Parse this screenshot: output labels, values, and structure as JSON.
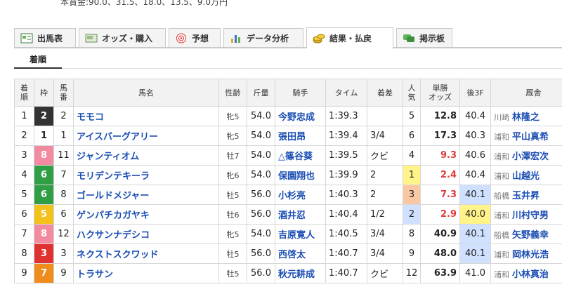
{
  "prize_text": "本賞金:90.0、31.5、18.0、13.5、9.0万円",
  "tabs": [
    {
      "label": "出馬表",
      "icon": "race-card-icon",
      "active": false
    },
    {
      "label": "オッズ・購入",
      "icon": "ticket-icon",
      "active": false
    },
    {
      "label": "予想",
      "icon": "target-icon",
      "active": false
    },
    {
      "label": "データ分析",
      "icon": "bar-chart-icon",
      "active": false
    },
    {
      "label": "結果・払戻",
      "icon": "coins-icon",
      "active": true
    },
    {
      "label": "掲示板",
      "icon": "chat-icon",
      "active": false
    }
  ],
  "subtab": "着順",
  "headers": [
    "着\n順",
    "枠",
    "馬\n番",
    "馬名",
    "性齢",
    "斤量",
    "騎手",
    "タイム",
    "着差",
    "人\n気",
    "単勝\nオッズ",
    "後3F",
    "厩舎"
  ],
  "waku_colors": {
    "1": {
      "bg": "#ffffff",
      "fg": "#222222"
    },
    "2": {
      "bg": "#333333",
      "fg": "#ffffff"
    },
    "5": {
      "bg": "#f2c21b",
      "fg": "#ffffff"
    },
    "6": {
      "bg": "#2f9e44",
      "fg": "#ffffff"
    },
    "7": {
      "bg": "#f08c1e",
      "fg": "#ffffff"
    },
    "8": {
      "bg": "#f28aa0",
      "fg": "#ffffff"
    },
    "3": {
      "bg": "#e03131",
      "fg": "#ffffff"
    }
  },
  "rows": [
    {
      "rank": "1",
      "waku": "2",
      "num": "2",
      "horse": "モモコ",
      "sexage": "牝5",
      "weight": "54.0",
      "jockey": "今野忠成",
      "time": "1:39.3",
      "margin": "",
      "pop": "5",
      "pop_hl": "",
      "odds": "12.8",
      "odds_red": false,
      "last3f": "40.4",
      "f3_hl": "",
      "region": "川崎",
      "trainer": "林隆之"
    },
    {
      "rank": "2",
      "waku": "1",
      "num": "1",
      "horse": "アイスバーグアリー",
      "sexage": "牝5",
      "weight": "54.0",
      "jockey": "張田昂",
      "time": "1:39.4",
      "margin": "3/4",
      "pop": "6",
      "pop_hl": "",
      "odds": "17.3",
      "odds_red": false,
      "last3f": "40.3",
      "f3_hl": "",
      "region": "浦和",
      "trainer": "平山真希"
    },
    {
      "rank": "3",
      "waku": "8",
      "num": "11",
      "horse": "ジャンティオム",
      "sexage": "牡7",
      "weight": "54.0",
      "jockey": "△篠谷葵",
      "time": "1:39.5",
      "margin": "クビ",
      "pop": "4",
      "pop_hl": "",
      "odds": "9.3",
      "odds_red": true,
      "last3f": "40.6",
      "f3_hl": "",
      "region": "浦和",
      "trainer": "小澤宏次"
    },
    {
      "rank": "4",
      "waku": "6",
      "num": "7",
      "horse": "モリデンテキーラ",
      "sexage": "牝6",
      "weight": "54.0",
      "jockey": "保園翔也",
      "time": "1:39.9",
      "margin": "2",
      "pop": "1",
      "pop_hl": "rank1",
      "odds": "2.4",
      "odds_red": true,
      "last3f": "40.4",
      "f3_hl": "",
      "region": "浦和",
      "trainer": "山越光"
    },
    {
      "rank": "5",
      "waku": "6",
      "num": "8",
      "horse": "ゴールドメジャー",
      "sexage": "牡5",
      "weight": "56.0",
      "jockey": "小杉亮",
      "time": "1:40.3",
      "margin": "2",
      "pop": "3",
      "pop_hl": "rank3",
      "odds": "7.3",
      "odds_red": true,
      "last3f": "40.1",
      "f3_hl": "rank2",
      "region": "船橋",
      "trainer": "玉井昇"
    },
    {
      "rank": "6",
      "waku": "5",
      "num": "6",
      "horse": "ゲンパチカガヤキ",
      "sexage": "牡6",
      "weight": "56.0",
      "jockey": "酒井忍",
      "time": "1:40.4",
      "margin": "1/2",
      "pop": "2",
      "pop_hl": "rank2",
      "odds": "2.9",
      "odds_red": true,
      "last3f": "40.0",
      "f3_hl": "rank1",
      "region": "浦和",
      "trainer": "川村守男"
    },
    {
      "rank": "7",
      "waku": "8",
      "num": "12",
      "horse": "ハクサンナデシコ",
      "sexage": "牝5",
      "weight": "54.0",
      "jockey": "吉原寛人",
      "time": "1:40.5",
      "margin": "3/4",
      "pop": "8",
      "pop_hl": "",
      "odds": "40.9",
      "odds_red": false,
      "last3f": "40.1",
      "f3_hl": "rank2",
      "region": "船橋",
      "trainer": "矢野義幸"
    },
    {
      "rank": "8",
      "waku": "3",
      "num": "3",
      "horse": "ネクストスクワッド",
      "sexage": "牡5",
      "weight": "56.0",
      "jockey": "西啓太",
      "time": "1:40.7",
      "margin": "3/4",
      "pop": "9",
      "pop_hl": "",
      "odds": "48.0",
      "odds_red": false,
      "last3f": "40.1",
      "f3_hl": "rank2",
      "region": "浦和",
      "trainer": "岡林光浩"
    },
    {
      "rank": "9",
      "waku": "7",
      "num": "9",
      "horse": "トラサン",
      "sexage": "牡5",
      "weight": "56.0",
      "jockey": "秋元耕成",
      "time": "1:40.7",
      "margin": "クビ",
      "pop": "12",
      "pop_hl": "",
      "odds": "63.9",
      "odds_red": false,
      "last3f": "41.0",
      "f3_hl": "",
      "region": "浦和",
      "trainer": "小林真治"
    }
  ]
}
